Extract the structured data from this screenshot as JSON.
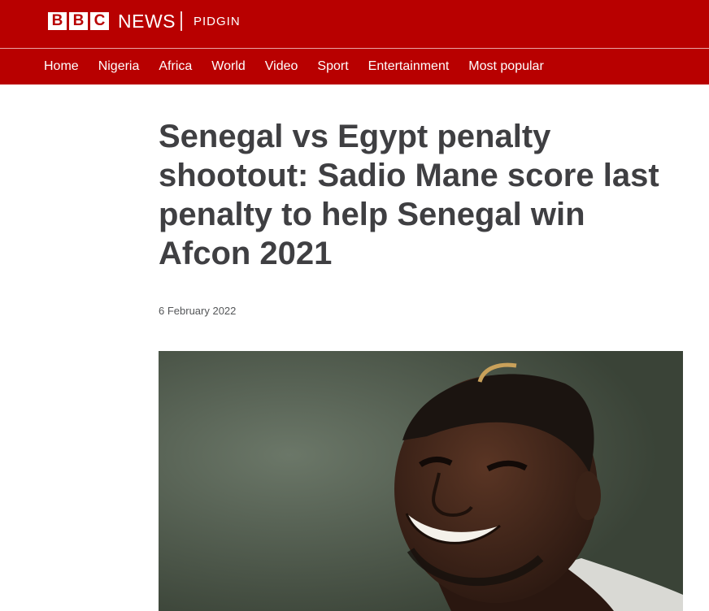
{
  "header": {
    "logo_letters": [
      "B",
      "B",
      "C"
    ],
    "brand": "NEWS",
    "service": "PIDGIN",
    "colors": {
      "brand_red": "#b80000",
      "text": "#3f3f42"
    }
  },
  "nav": {
    "items": [
      "Home",
      "Nigeria",
      "Africa",
      "World",
      "Video",
      "Sport",
      "Entertainment",
      "Most popular"
    ]
  },
  "article": {
    "headline": "Senegal vs Egypt penalty shootout: Sadio Mane score last penalty to help Senegal win Afcon 2021",
    "date": "6 February 2022",
    "image_subject": "smiling footballer photo"
  }
}
